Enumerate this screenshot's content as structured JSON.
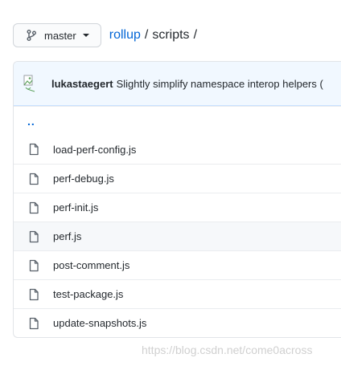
{
  "branch": {
    "label": "master",
    "icon": "git-branch-icon"
  },
  "breadcrumb": {
    "repo": "rollup",
    "separator": "/",
    "dir": "scripts",
    "trailing_separator": "/"
  },
  "commit": {
    "author": "lukastaegert",
    "message": "Slightly simplify namespace interop helpers ("
  },
  "parent_link": "..",
  "files": [
    {
      "name": "load-perf-config.js",
      "icon": "file-icon"
    },
    {
      "name": "perf-debug.js",
      "icon": "file-icon"
    },
    {
      "name": "perf-init.js",
      "icon": "file-icon"
    },
    {
      "name": "perf.js",
      "icon": "file-icon"
    },
    {
      "name": "post-comment.js",
      "icon": "file-icon"
    },
    {
      "name": "test-package.js",
      "icon": "file-icon"
    },
    {
      "name": "update-snapshots.js",
      "icon": "file-icon"
    }
  ],
  "watermark": "https://blog.csdn.net/come0across",
  "colors": {
    "link": "#0366d6",
    "commit_bg": "#f1f8ff",
    "hover_row_bg": "#f6f8fa"
  }
}
